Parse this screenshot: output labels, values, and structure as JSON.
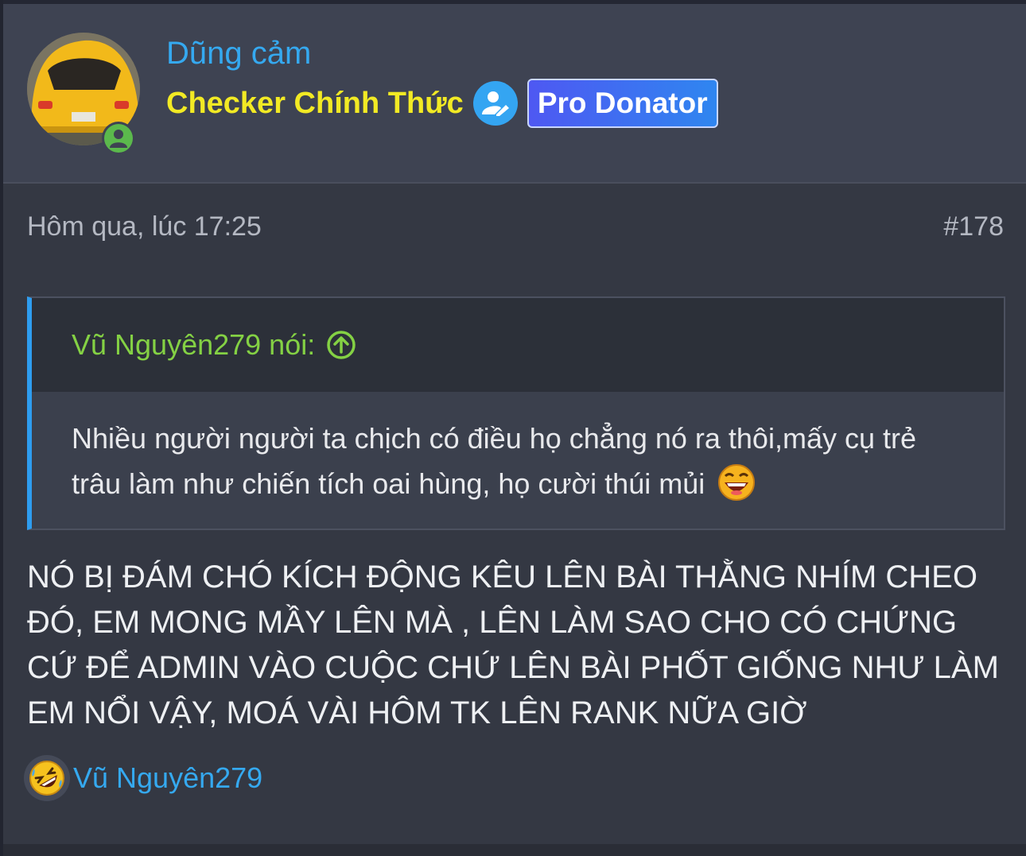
{
  "user": {
    "name": "Dũng cảm",
    "title": "Checker Chính Thức",
    "verify_icon": "user-edit-icon",
    "badge": "Pro Donator",
    "online_icon": "online-user-icon"
  },
  "post": {
    "date": "Hôm qua, lúc 17:25",
    "number": "#178"
  },
  "quote": {
    "author": "Vũ Nguyên279 nói:",
    "text": "Nhiều người người ta chịch có điều họ chẳng nó ra thôi,mấy cụ trẻ trâu làm như chiến tích oai hùng, họ cười thúi mủi",
    "arrow_icon": "arrow-up-circle-icon",
    "emoji": "laughing-emoji"
  },
  "message": "NÓ BỊ ĐÁM CHÓ KÍCH ĐỘNG KÊU LÊN BÀI THẰNG NHÍM CHEO ĐÓ, EM MONG MẦY LÊN MÀ , LÊN LÀM SAO CHO CÓ CHỨNG CỨ ĐỂ ADMIN VÀO CUỘC CHỨ LÊN BÀI PHỐT GIỐNG NHƯ LÀM EM NỔI VẬY, MOÁ VÀI HÔM TK LÊN RANK NỮA GIỜ",
  "reactions": {
    "icon": "rolling-laugh-emoji",
    "users": "Vũ Nguyên279"
  },
  "colors": {
    "username": "#35a9f0",
    "title": "#f2ea24",
    "quote_author": "#84d144",
    "quote_border": "#2e9df0",
    "online": "#5bb94c"
  }
}
